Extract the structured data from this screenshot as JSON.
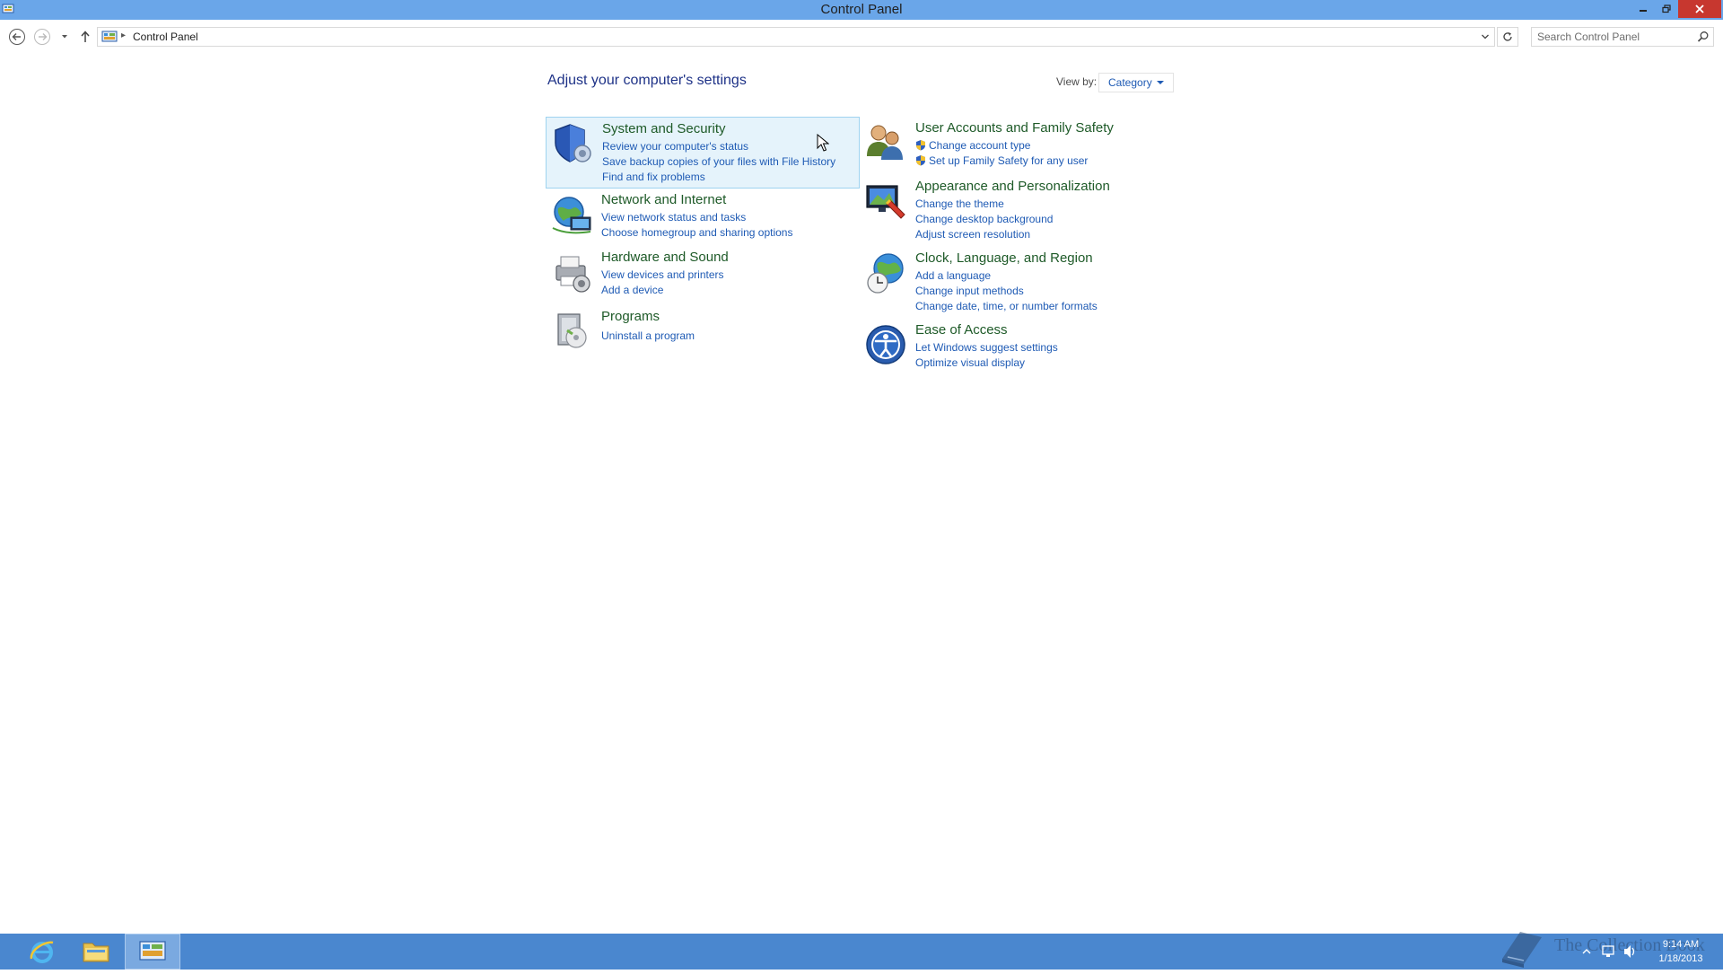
{
  "window": {
    "title": "Control Panel"
  },
  "nav": {
    "breadcrumb": "Control Panel",
    "search_placeholder": "Search Control Panel"
  },
  "main": {
    "heading": "Adjust your computer's settings",
    "view_by_label": "View by:",
    "view_by_value": "Category"
  },
  "categories": [
    {
      "title": "System and Security",
      "icon": "shield-icon",
      "links": [
        "Review your computer's status",
        "Save backup copies of your files with File History",
        "Find and fix problems"
      ]
    },
    {
      "title": "Network and Internet",
      "icon": "network-globe-icon",
      "links": [
        "View network status and tasks",
        "Choose homegroup and sharing options"
      ]
    },
    {
      "title": "Hardware and Sound",
      "icon": "printer-icon",
      "links": [
        "View devices and printers",
        "Add a device"
      ]
    },
    {
      "title": "Programs",
      "icon": "programs-icon",
      "links": [
        "Uninstall a program"
      ]
    },
    {
      "title": "User Accounts and Family Safety",
      "icon": "users-icon",
      "links": [
        "Change account type",
        "Set up Family Safety for any user"
      ]
    },
    {
      "title": "Appearance and Personalization",
      "icon": "monitor-paint-icon",
      "links": [
        "Change the theme",
        "Change desktop background",
        "Adjust screen resolution"
      ]
    },
    {
      "title": "Clock, Language, and Region",
      "icon": "globe-clock-icon",
      "links": [
        "Add a language",
        "Change input methods",
        "Change date, time, or number formats"
      ]
    },
    {
      "title": "Ease of Access",
      "icon": "ease-of-access-icon",
      "links": [
        "Let Windows suggest settings",
        "Optimize visual display"
      ]
    }
  ],
  "taskbar": {
    "watermark": "The Collection Book",
    "time": "9:14 AM",
    "date": "1/18/2013"
  },
  "colors": {
    "titlebar": "#6aa6e9",
    "taskbar": "#4a87cf",
    "link": "#1e5ab4",
    "category_title": "#1e5a28",
    "heading": "#1e3287",
    "highlight": "#e5f3fb"
  }
}
